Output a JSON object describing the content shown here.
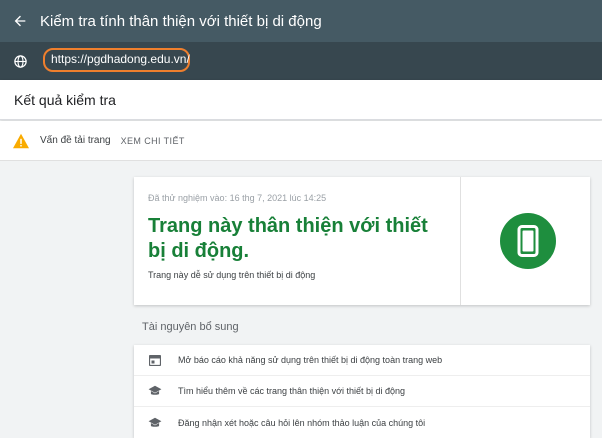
{
  "topbar": {
    "title": "Kiểm tra tính thân thiện với thiết bị di động"
  },
  "urlbar": {
    "url": "https://pgdhadong.edu.vn/"
  },
  "results": {
    "title": "Kết quả kiểm tra"
  },
  "issue": {
    "label": "Vấn đề tải trang",
    "link": "XEM CHI TIẾT"
  },
  "card": {
    "tested": "Đã thử nghiệm vào: 16 thg 7, 2021 lúc 14:25",
    "heading": "Trang này thân thiện với thiết bị di động.",
    "subtitle": "Trang này dễ sử dụng trên thiết bị di động"
  },
  "resources": {
    "title": "Tài nguyên bổ sung",
    "items": [
      {
        "icon": "report-icon",
        "label": "Mở báo cáo khả năng sử dụng trên thiết bị di động toàn trang web"
      },
      {
        "icon": "school-icon",
        "label": "Tìm hiểu thêm về các trang thân thiện với thiết bị di động"
      },
      {
        "icon": "school-icon",
        "label": "Đăng nhận xét hoặc câu hỏi lên nhóm thảo luận của chúng tôi"
      }
    ]
  },
  "colors": {
    "header": "#455a64",
    "url_bar": "#37474f",
    "success": "#188038",
    "warning": "#f9ab00",
    "highlight": "#ef7f2d"
  }
}
